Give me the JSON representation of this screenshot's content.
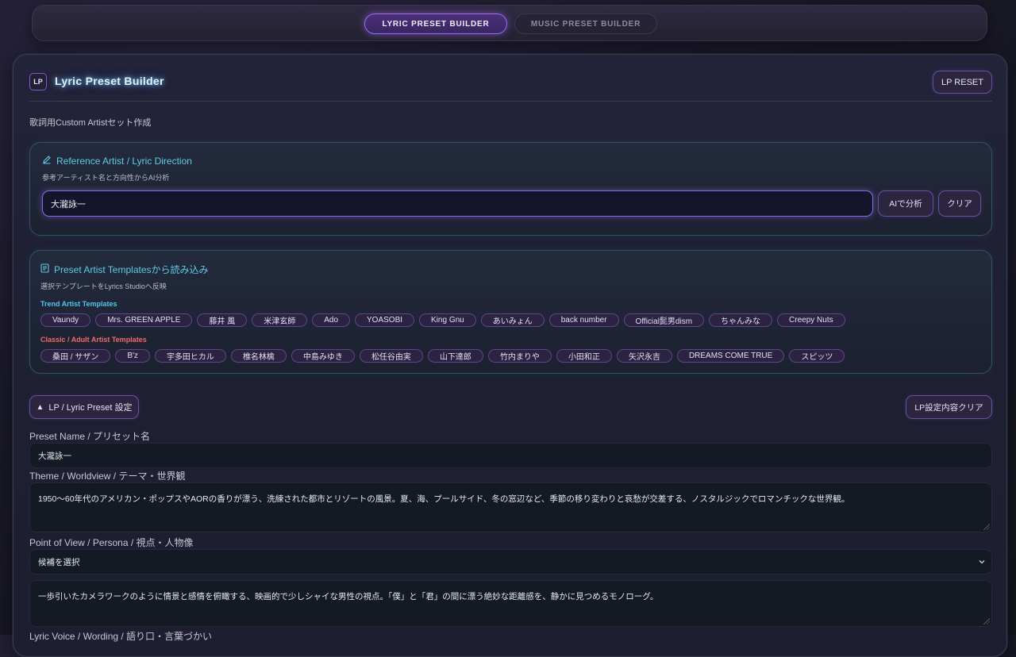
{
  "mode_tabs": {
    "lyric": "LYRIC PRESET BUILDER",
    "music": "MUSIC PRESET BUILDER"
  },
  "header": {
    "badge": "LP",
    "title": "Lyric Preset Builder",
    "reset_label": "LP RESET",
    "subtitle": "歌詞用Custom Artistセット作成"
  },
  "reference": {
    "title": "Reference Artist / Lyric Direction",
    "icon": "pencil-icon",
    "subtitle": "参考アーティスト名と方向性からAI分析",
    "input_value": "大瀧詠一",
    "analyze_label": "AIで分析",
    "clear_label": "クリア"
  },
  "templates": {
    "title": "Preset Artist Templatesから読み込み",
    "icon": "book-icon",
    "subtitle": "選択テンプレートをLyrics Studioへ反映",
    "trend_label": "Trend Artist Templates",
    "trend": [
      "Vaundy",
      "Mrs. GREEN APPLE",
      "藤井 風",
      "米津玄師",
      "Ado",
      "YOASOBI",
      "King Gnu",
      "あいみょん",
      "back number",
      "Official髭男dism",
      "ちゃんみな",
      "Creepy Nuts"
    ],
    "classic_label": "Classic / Adult Artist Templates",
    "classic": [
      "桑田 / サザン",
      "B'z",
      "宇多田ヒカル",
      "椎名林檎",
      "中島みゆき",
      "松任谷由実",
      "山下達郎",
      "竹内まりや",
      "小田和正",
      "矢沢永吉",
      "DREAMS COME TRUE",
      "スピッツ"
    ],
    "colors": {
      "trend": "#4fc8e8",
      "classic": "#f06a6a"
    }
  },
  "settings": {
    "toggle_icon": "▲",
    "toggle_label": "LP / Lyric Preset 設定",
    "clear_label": "LP設定内容クリア"
  },
  "form": {
    "preset_name_label": "Preset Name / プリセット名",
    "preset_name_value": "大瀧詠一",
    "theme_label": "Theme / Worldview / テーマ・世界観",
    "theme_value": "1950〜60年代のアメリカン・ポップスやAORの香りが漂う、洗練された都市とリゾートの風景。夏、海、プールサイド、冬の窓辺など、季節の移り変わりと哀愁が交差する、ノスタルジックでロマンチックな世界観。",
    "pov_label": "Point of View / Persona / 視点・人物像",
    "pov_select": "候補を選択",
    "pov_value": "一歩引いたカメラワークのように情景と感情を俯瞰する、映画的で少しシャイな男性の視点。「僕」と「君」の間に漂う絶妙な距離感を、静かに見つめるモノローグ。",
    "voice_label": "Lyric Voice / Wording / 語り口・言葉づかい"
  }
}
